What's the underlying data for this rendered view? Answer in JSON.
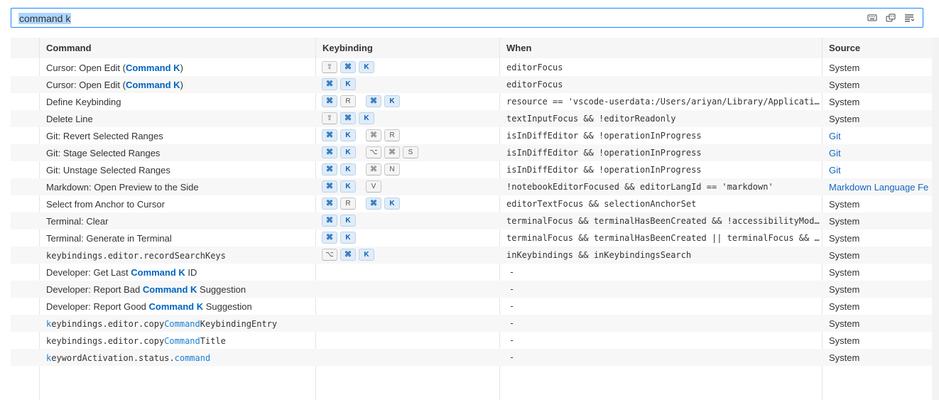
{
  "search": {
    "value": "command k"
  },
  "search_icons": [
    "keyboard-icon",
    "record-keys-icon",
    "sort-by-precedence-icon"
  ],
  "headers": {
    "command": "Command",
    "keybinding": "Keybinding",
    "when": "When",
    "source": "Source"
  },
  "rows": [
    {
      "cmd": [
        {
          "t": "Cursor: Open Edit ("
        },
        {
          "t": "Command K",
          "hl": true
        },
        {
          "t": ")"
        }
      ],
      "keys": [
        [
          "⇧",
          0
        ],
        [
          "⌘",
          1
        ],
        [
          "K",
          1
        ]
      ],
      "when": "editorFocus",
      "source": "System"
    },
    {
      "cmd": [
        {
          "t": "Cursor: Open Edit ("
        },
        {
          "t": "Command K",
          "hl": true
        },
        {
          "t": ")"
        }
      ],
      "keys": [
        [
          "⌘",
          1
        ],
        [
          "K",
          1
        ]
      ],
      "when": "editorFocus",
      "source": "System"
    },
    {
      "cmd": [
        {
          "t": "Define Keybinding"
        }
      ],
      "keys": [
        [
          "⌘",
          1
        ],
        [
          "R",
          0
        ],
        [
          "|",
          0
        ],
        [
          "⌘",
          1
        ],
        [
          "K",
          1
        ]
      ],
      "when": "resource == 'vscode-userdata:/Users/ariyan/Library/Application…",
      "source": "System"
    },
    {
      "cmd": [
        {
          "t": "Delete Line"
        }
      ],
      "keys": [
        [
          "⇧",
          0
        ],
        [
          "⌘",
          1
        ],
        [
          "K",
          1
        ]
      ],
      "when": "textInputFocus && !editorReadonly",
      "source": "System"
    },
    {
      "cmd": [
        {
          "t": "Git: Revert Selected Ranges"
        }
      ],
      "keys": [
        [
          "⌘",
          1
        ],
        [
          "K",
          1
        ],
        [
          "|",
          0
        ],
        [
          "⌘",
          0
        ],
        [
          "R",
          0
        ]
      ],
      "when": "isInDiffEditor && !operationInProgress",
      "source": "Git",
      "link": true
    },
    {
      "cmd": [
        {
          "t": "Git: Stage Selected Ranges"
        }
      ],
      "keys": [
        [
          "⌘",
          1
        ],
        [
          "K",
          1
        ],
        [
          "|",
          0
        ],
        [
          "⌥",
          0
        ],
        [
          "⌘",
          0
        ],
        [
          "S",
          0
        ]
      ],
      "when": "isInDiffEditor && !operationInProgress",
      "source": "Git",
      "link": true
    },
    {
      "cmd": [
        {
          "t": "Git: Unstage Selected Ranges"
        }
      ],
      "keys": [
        [
          "⌘",
          1
        ],
        [
          "K",
          1
        ],
        [
          "|",
          0
        ],
        [
          "⌘",
          0
        ],
        [
          "N",
          0
        ]
      ],
      "when": "isInDiffEditor && !operationInProgress",
      "source": "Git",
      "link": true
    },
    {
      "cmd": [
        {
          "t": "Markdown: Open Preview to the Side"
        }
      ],
      "keys": [
        [
          "⌘",
          1
        ],
        [
          "K",
          1
        ],
        [
          "|",
          0
        ],
        [
          "V",
          0
        ]
      ],
      "when": "!notebookEditorFocused && editorLangId == 'markdown'",
      "source": "Markdown Language Fe",
      "link": true
    },
    {
      "cmd": [
        {
          "t": "Select from Anchor to Cursor"
        }
      ],
      "keys": [
        [
          "⌘",
          1
        ],
        [
          "R",
          0
        ],
        [
          "|",
          0
        ],
        [
          "⌘",
          1
        ],
        [
          "K",
          1
        ]
      ],
      "when": "editorTextFocus && selectionAnchorSet",
      "source": "System"
    },
    {
      "cmd": [
        {
          "t": "Terminal: Clear"
        }
      ],
      "keys": [
        [
          "⌘",
          1
        ],
        [
          "K",
          1
        ]
      ],
      "when": "terminalFocus && terminalHasBeenCreated && !accessibilityModeE…",
      "source": "System"
    },
    {
      "cmd": [
        {
          "t": "Terminal: Generate in Terminal"
        }
      ],
      "keys": [
        [
          "⌘",
          1
        ],
        [
          "K",
          1
        ]
      ],
      "when": "terminalFocus && terminalHasBeenCreated || terminalFocus && te…",
      "source": "System"
    },
    {
      "cmd": [
        {
          "t": "keybindings.editor.recordSearchKeys",
          "mono": true
        }
      ],
      "keys": [
        [
          "⌥",
          0
        ],
        [
          "⌘",
          1
        ],
        [
          "K",
          1
        ]
      ],
      "when": "inKeybindings && inKeybindingsSearch",
      "source": "System"
    },
    {
      "cmd": [
        {
          "t": "Developer: Get Last "
        },
        {
          "t": "Command K",
          "hl": true
        },
        {
          "t": " ID"
        }
      ],
      "keys": [],
      "when": "-",
      "source": "System"
    },
    {
      "cmd": [
        {
          "t": "Developer: Report Bad "
        },
        {
          "t": "Command K",
          "hl": true
        },
        {
          "t": " Suggestion"
        }
      ],
      "keys": [],
      "when": "-",
      "source": "System"
    },
    {
      "cmd": [
        {
          "t": "Developer: Report Good "
        },
        {
          "t": "Command K",
          "hl": true
        },
        {
          "t": " Suggestion"
        }
      ],
      "keys": [],
      "when": "-",
      "source": "System"
    },
    {
      "cmd": [
        {
          "t": "k",
          "hlm": true,
          "mono": true
        },
        {
          "t": "eybindings.editor.copy",
          "mono": true
        },
        {
          "t": "Command",
          "hlm": true,
          "mono": true
        },
        {
          "t": "KeybindingEntry",
          "mono": true
        }
      ],
      "keys": [],
      "when": "-",
      "source": "System"
    },
    {
      "cmd": [
        {
          "t": "keybindings.editor.copy",
          "mono": true
        },
        {
          "t": "Command",
          "hlm": true,
          "mono": true
        },
        {
          "t": "Title",
          "mono": true
        }
      ],
      "keys": [],
      "when": "-",
      "source": "System"
    },
    {
      "cmd": [
        {
          "t": "k",
          "hlm": true,
          "mono": true
        },
        {
          "t": "eywordActivation.status.",
          "mono": true
        },
        {
          "t": "command",
          "hlm": true,
          "mono": true
        }
      ],
      "keys": [],
      "when": "-",
      "source": "System"
    }
  ]
}
